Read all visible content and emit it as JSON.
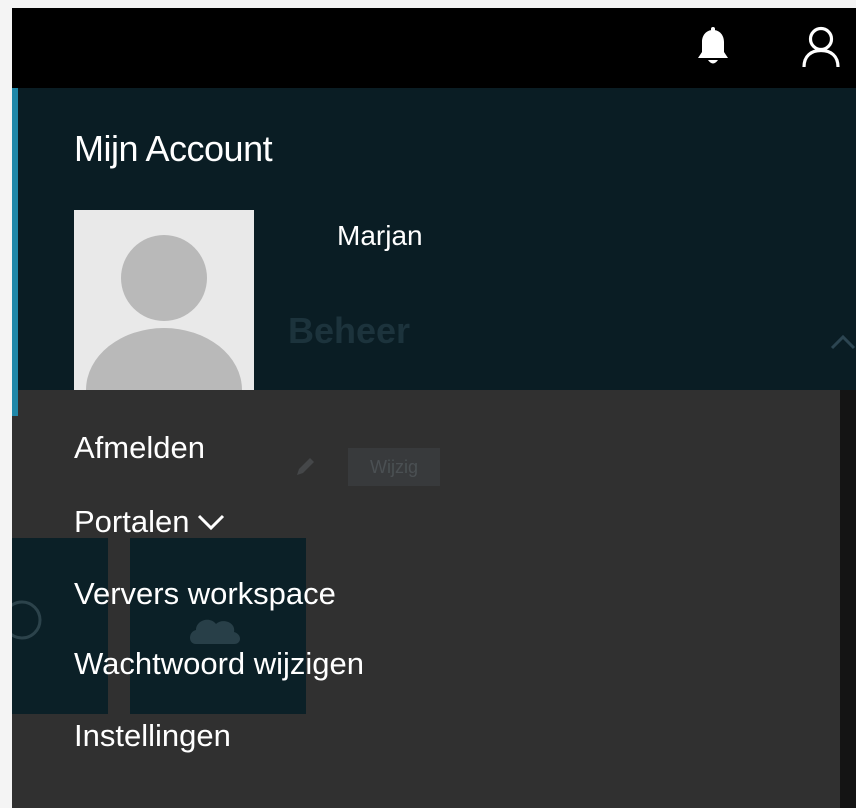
{
  "topbar": {
    "icons": [
      "bell-icon",
      "user-icon"
    ]
  },
  "account": {
    "title": "Mijn Account",
    "user_name": "Marjan",
    "avatar_icon": "default-avatar-icon"
  },
  "background": {
    "section_title": "Beheer",
    "edit_label": "Wijzig"
  },
  "menu": {
    "items": [
      {
        "label": "Afmelden"
      },
      {
        "label": "Portalen",
        "icon": "chevron-down-icon"
      },
      {
        "label": "Ververs workspace"
      },
      {
        "label": "Wachtwoord wijzigen"
      },
      {
        "label": "Instellingen"
      }
    ]
  },
  "colors": {
    "topbar": "#000000",
    "header": "#0a1d24",
    "accent": "#1f87a8",
    "menu_bg": "#303030",
    "text": "#ffffff"
  }
}
